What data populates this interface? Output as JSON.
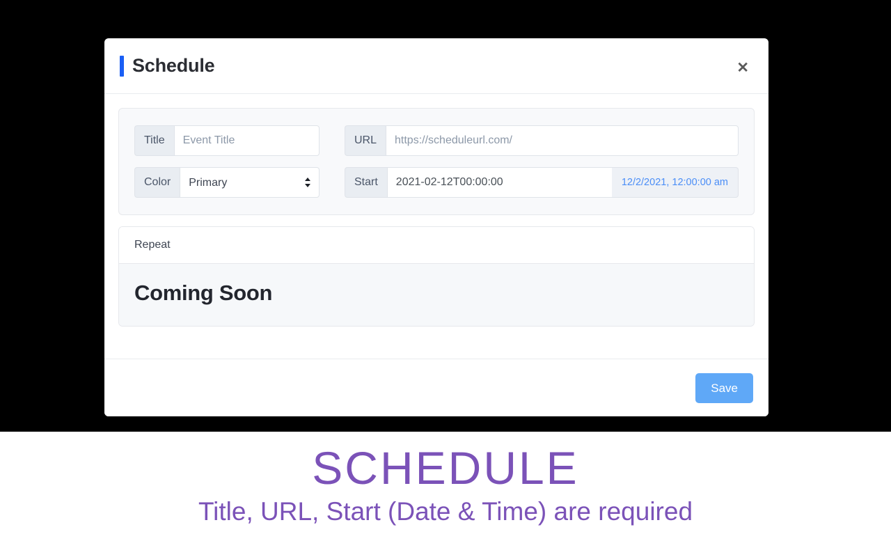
{
  "modal": {
    "title": "Schedule",
    "close_label": "✕",
    "accent_color": "#1a5ff5",
    "fields": {
      "title": {
        "label": "Title",
        "placeholder": "Event Title",
        "value": ""
      },
      "color": {
        "label": "Color",
        "value": "Primary",
        "options": [
          "Primary"
        ]
      },
      "url": {
        "label": "URL",
        "placeholder": "https://scheduleurl.com/",
        "value": ""
      },
      "start": {
        "label": "Start",
        "value": "2021-02-12T00:00:00",
        "formatted": "12/2/2021, 12:00:00 am",
        "formatted_color": "#4b8ef7"
      }
    },
    "repeat": {
      "header": "Repeat",
      "body": "Coming Soon"
    },
    "footer": {
      "save_label": "Save",
      "save_color": "#5fa8f7"
    }
  },
  "caption": {
    "title": "SCHEDULE",
    "subtitle": "Title, URL, Start (Date & Time) are required",
    "color": "#7b52b8"
  }
}
